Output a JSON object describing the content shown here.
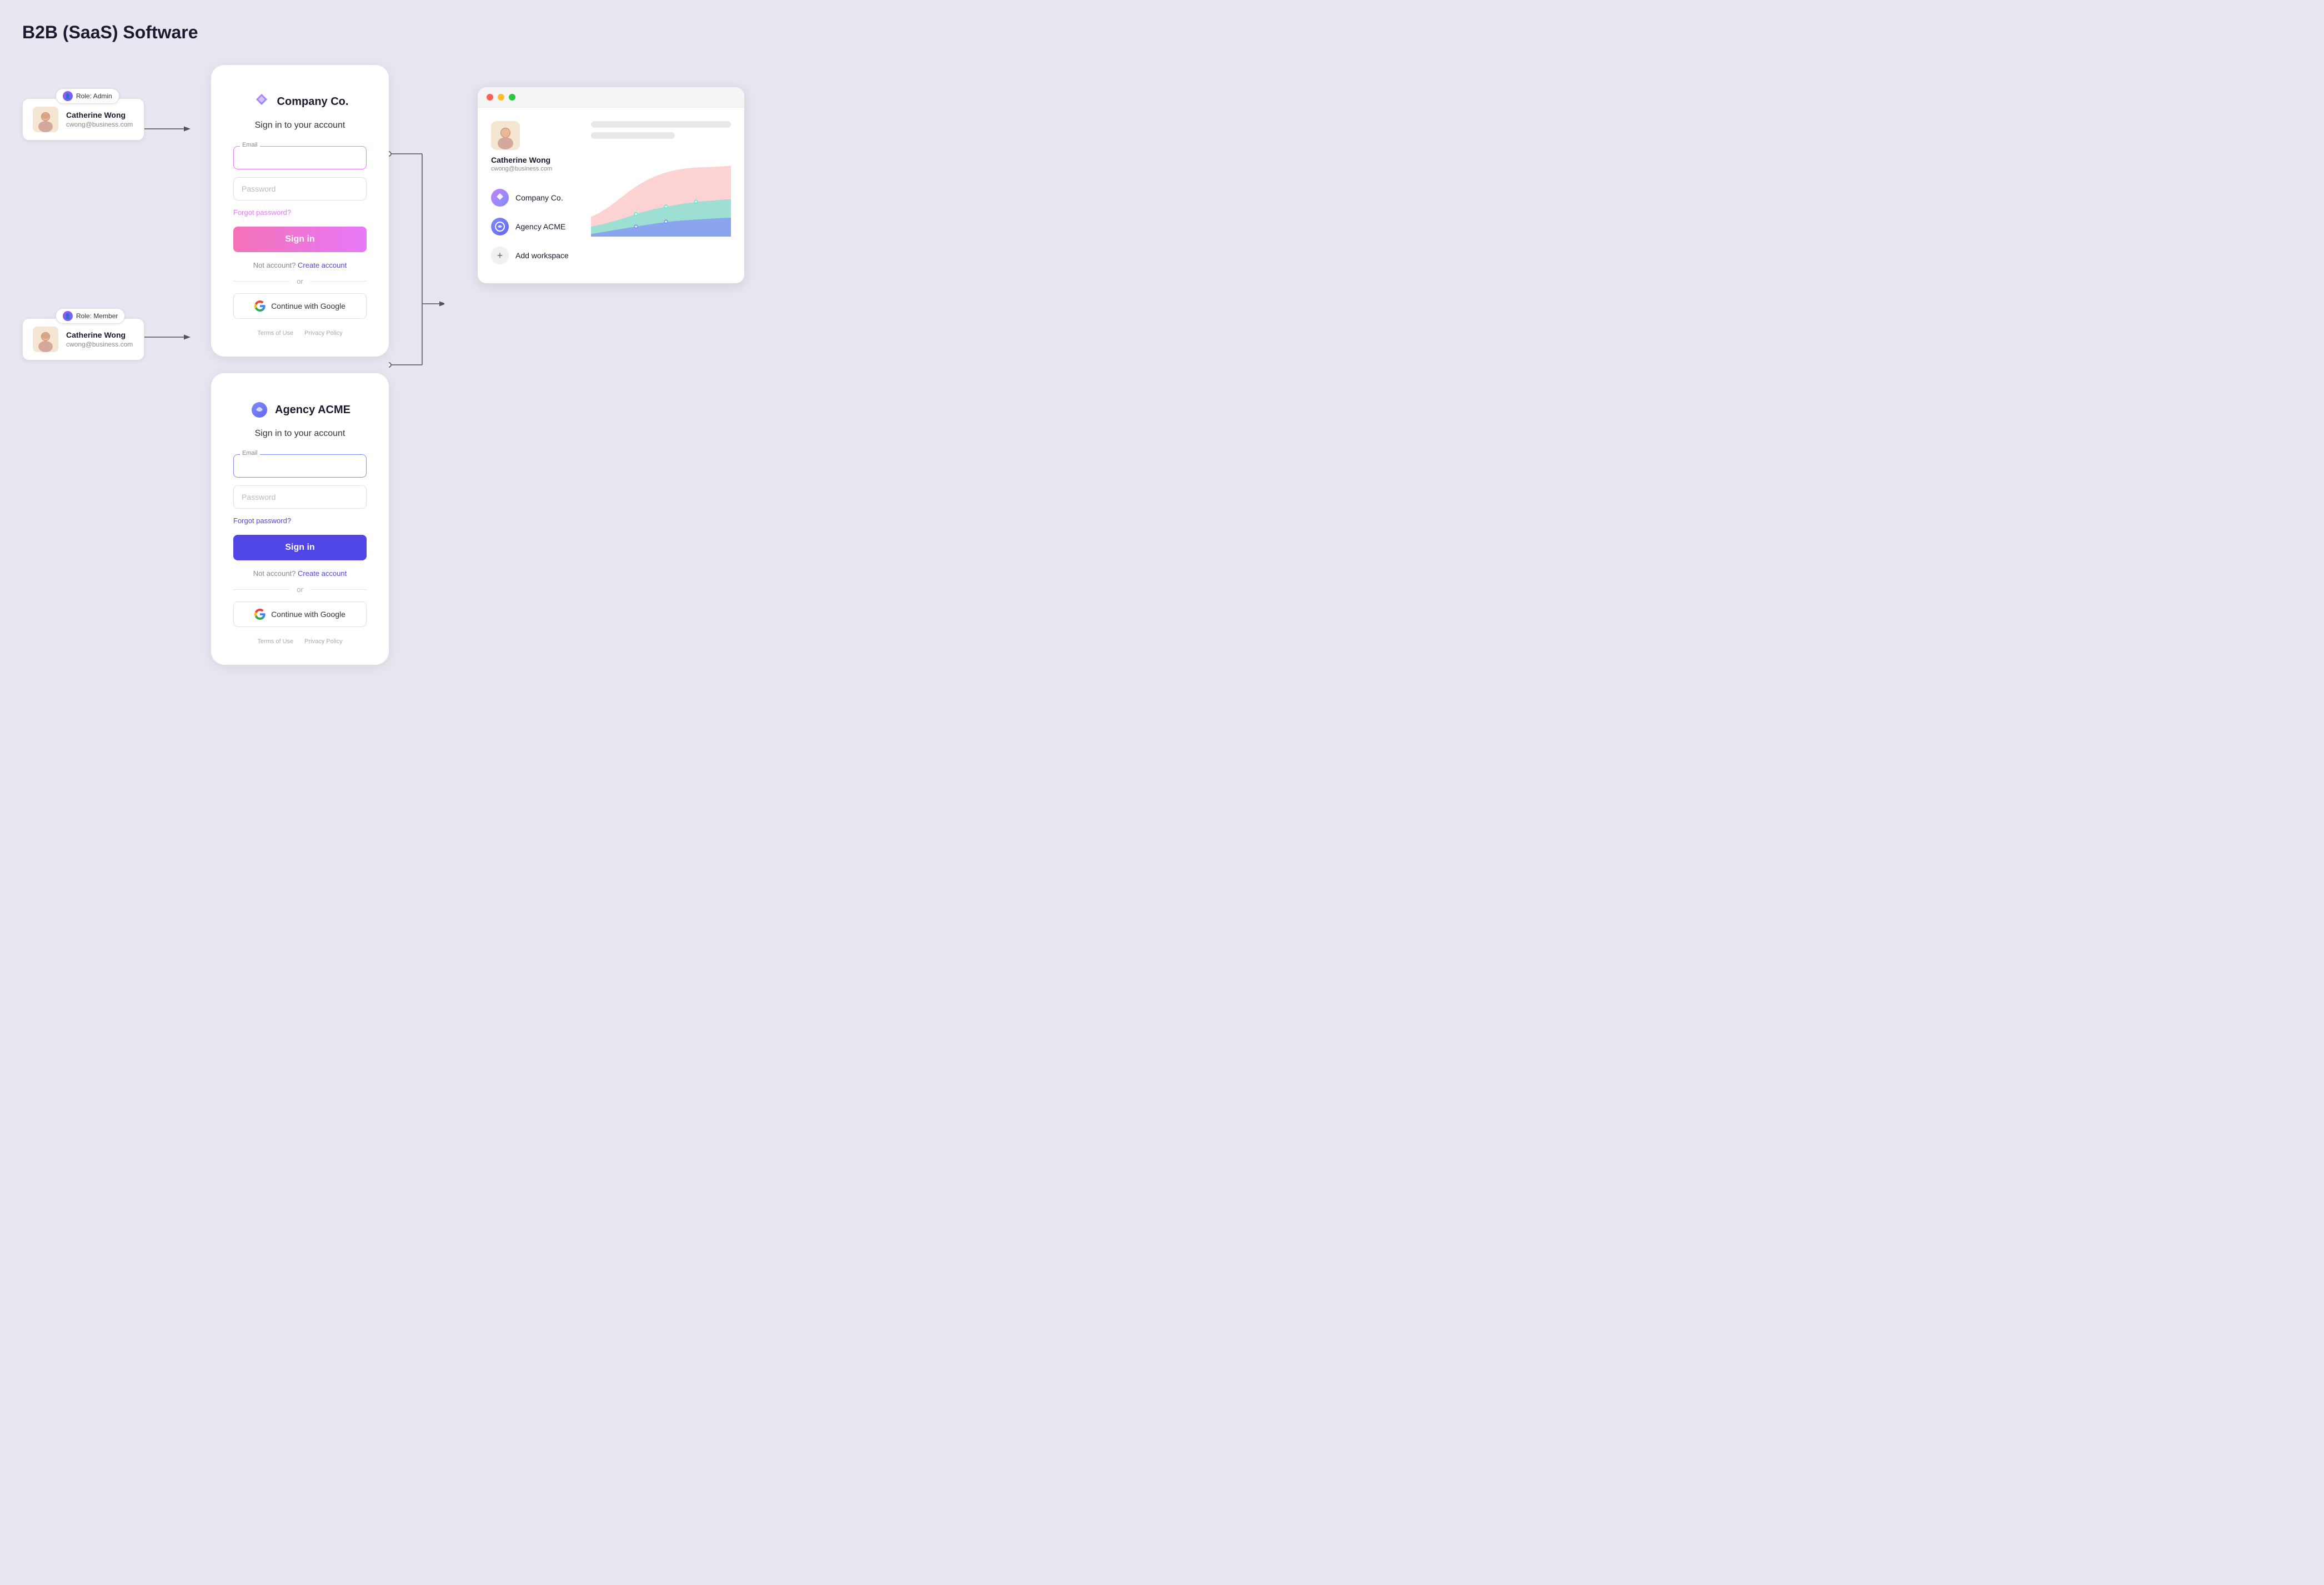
{
  "page": {
    "title": "B2B (SaaS) Software"
  },
  "user": {
    "name": "Catherine Wong",
    "email": "cwong@business.com"
  },
  "card1": {
    "logo_text": "Company Co.",
    "subtitle": "Sign in to your account",
    "email_label": "Email",
    "email_placeholder": "",
    "password_placeholder": "Password",
    "forgot_text": "Forgot password?",
    "sign_in_label": "Sign in",
    "no_account_text": "Not account?",
    "create_account_label": "Create account",
    "or_text": "or",
    "google_btn_label": "Continue with Google",
    "terms_label": "Terms of Use",
    "privacy_label": "Privacy Policy",
    "role_badge": "Role: Admin"
  },
  "card2": {
    "logo_text": "Agency ACME",
    "subtitle": "Sign in to your account",
    "email_label": "Email",
    "email_placeholder": "",
    "password_placeholder": "Password",
    "forgot_text": "Forgot password?",
    "sign_in_label": "Sign in",
    "no_account_text": "Not account?",
    "create_account_label": "Create account",
    "or_text": "or",
    "google_btn_label": "Continue with Google",
    "terms_label": "Terms of Use",
    "privacy_label": "Privacy Policy",
    "role_badge": "Role: Member"
  },
  "workspace": {
    "profile_name": "Catherine Wong",
    "profile_email": "cwong@business.com",
    "items": [
      {
        "name": "Company Co.",
        "type": "company"
      },
      {
        "name": "Agency ACME",
        "type": "agency"
      },
      {
        "name": "Add workspace",
        "type": "add"
      }
    ]
  }
}
